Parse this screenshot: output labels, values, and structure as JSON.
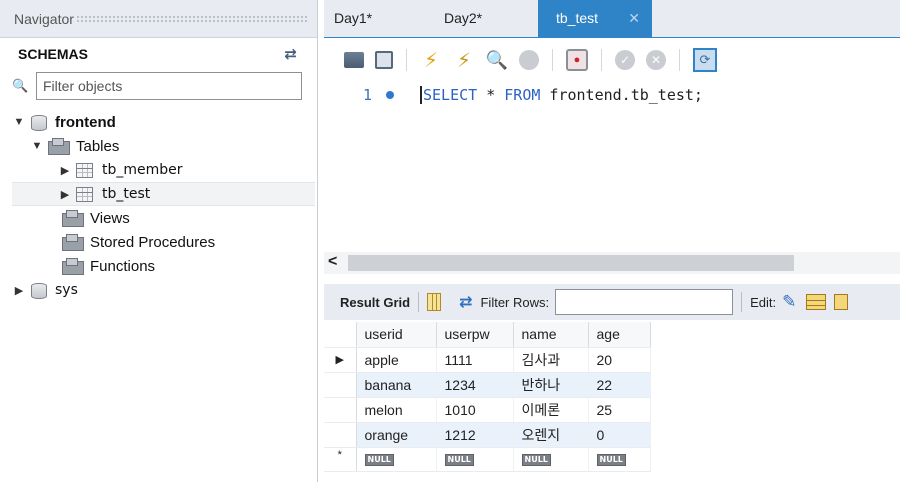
{
  "navigator": {
    "title": "Navigator",
    "schemas_label": "SCHEMAS",
    "filter_placeholder": "Filter objects",
    "tree": {
      "db1": "frontend",
      "tables": "Tables",
      "table1": "tb_member",
      "table2": "tb_test",
      "views": "Views",
      "procs": "Stored Procedures",
      "functions": "Functions",
      "db2": "sys"
    }
  },
  "tabs": [
    {
      "label": "Day1*"
    },
    {
      "label": "Day2*"
    },
    {
      "label": "tb_test",
      "active": true
    }
  ],
  "editor": {
    "line_number": "1",
    "sql_kw1": "SELECT",
    "sql_mid": " * ",
    "sql_kw2": "FROM",
    "sql_rest": " frontend.tb_test;"
  },
  "result_bar": {
    "result_grid": "Result Grid",
    "filter_rows": "Filter Rows:",
    "edit": "Edit:"
  },
  "grid": {
    "columns": [
      "userid",
      "userpw",
      "name",
      "age"
    ],
    "rows": [
      [
        "apple",
        "1111",
        "김사과",
        "20"
      ],
      [
        "banana",
        "1234",
        "반하나",
        "22"
      ],
      [
        "melon",
        "1010",
        "이메론",
        "25"
      ],
      [
        "orange",
        "1212",
        "오렌지",
        "0"
      ]
    ],
    "null_label": "NULL",
    "current_row_marker": "▶",
    "new_row_marker": "*"
  }
}
